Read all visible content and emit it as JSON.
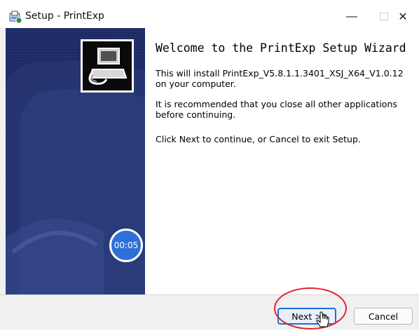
{
  "window": {
    "title": "Setup - PrintExp",
    "minimize_glyph": "—",
    "maximize_glyph": "☐",
    "close_glyph": "✕"
  },
  "wizard": {
    "heading": "Welcome to the PrintExp Setup Wizard",
    "paragraph1": "This will install PrintExp_V5.8.1.1.3401_XSJ_X64_V1.0.12 on your computer.",
    "paragraph2": "It is recommended that you close all other applications before continuing.",
    "paragraph3": "Click Next to continue, or Cancel to exit Setup."
  },
  "overlay": {
    "timer_text": "00:05"
  },
  "buttons": {
    "next_label": "Next >",
    "cancel_label": "Cancel"
  },
  "colors": {
    "sidepanel": "#1e2a63",
    "primary_button_border": "#1a6fd6",
    "annotation_circle": "#e0242c",
    "timer_badge": "#2f6fd9"
  },
  "icons": {
    "title": "setup-installer-icon",
    "logo": "printer-computer-icon",
    "pointer": "mouse-pointer-icon"
  }
}
